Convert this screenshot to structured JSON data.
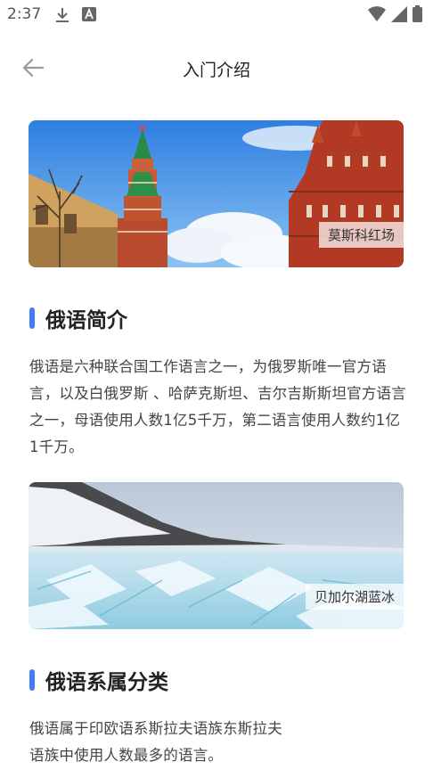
{
  "status": {
    "time": "2:37"
  },
  "header": {
    "title": "入门介绍"
  },
  "cards": [
    {
      "caption": "莫斯科红场"
    },
    {
      "caption": "贝加尔湖蓝冰"
    }
  ],
  "sections": [
    {
      "title": "俄语简介",
      "text": "俄语是六种联合国工作语言之一，为俄罗斯唯一官方语言，以及白俄罗斯 、哈萨克斯坦、吉尔吉斯斯坦官方语言之一，母语使用人数1亿5千万，第二语言使用人数约1亿1千万。"
    },
    {
      "title": "俄语系属分类",
      "text": "俄语属于印欧语系斯拉夫语族东斯拉夫语族中使用人数最多的语言。"
    }
  ]
}
